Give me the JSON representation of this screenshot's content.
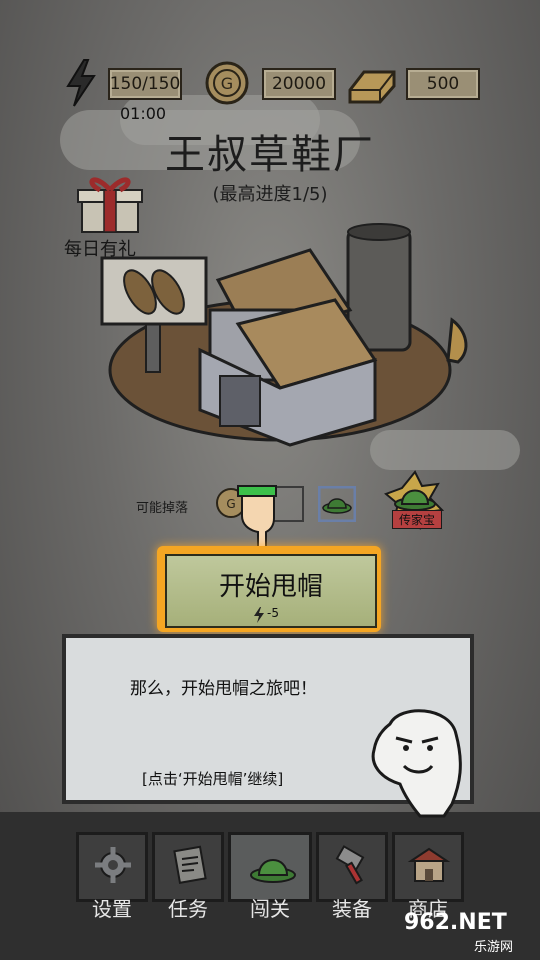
{
  "resources": {
    "energy_value": "150/150",
    "energy_timer": "01:00",
    "coins_value": "20000",
    "gold_value": "500"
  },
  "header": {
    "title": "王叔草鞋厂",
    "subtitle": "(最高进度1/5)"
  },
  "daily_gift": {
    "label": "每日有礼"
  },
  "drops": {
    "label": "可能掉落",
    "heirloom_label": "传家宝"
  },
  "start": {
    "label": "开始甩帽",
    "cost": "-5"
  },
  "dialog": {
    "text": "那么，开始甩帽之旅吧！",
    "hint": "[点击‘开始甩帽’继续]"
  },
  "bottom_nav": [
    {
      "label": "设置",
      "icon": "gear-icon"
    },
    {
      "label": "任务",
      "icon": "scroll-icon"
    },
    {
      "label": "闯关",
      "icon": "hat-icon",
      "active": true
    },
    {
      "label": "装备",
      "icon": "hammer-icon"
    },
    {
      "label": "商店",
      "icon": "shop-icon"
    }
  ],
  "watermark": {
    "text": "962.NET",
    "sub": "乐游网"
  },
  "colors": {
    "accent": "#f5a623",
    "button": "#a6b07a",
    "panel": "#d9dcdd"
  }
}
